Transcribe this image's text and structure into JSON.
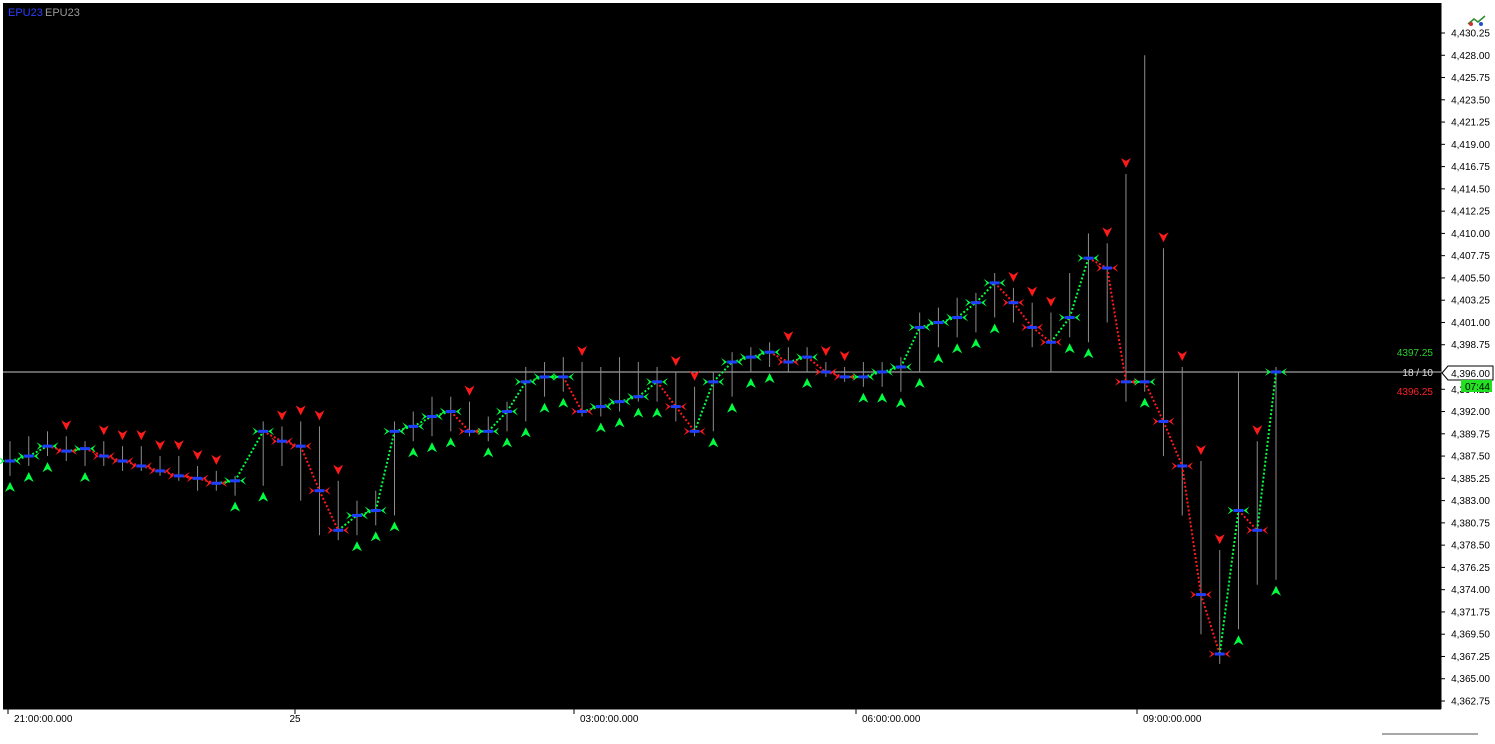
{
  "symbol": {
    "primary": "EPU23",
    "secondary": "EPU23"
  },
  "colors": {
    "background": "#000000",
    "axis_bg": "#ffffff",
    "bar": "#1f3fff",
    "wick": "#8c8c8c",
    "buy_arrow": "#00ff40",
    "sell_arrow": "#ff1a1a",
    "up_trail": "#00ff40",
    "down_trail": "#ff1a1a",
    "crosshair": "#c8c8c8"
  },
  "icons": {
    "top_right": "chart-options-icon"
  },
  "price_axis": {
    "ticks": [
      "4,430.25",
      "4,428.00",
      "4,425.75",
      "4,423.50",
      "4,421.25",
      "4,419.00",
      "4,416.75",
      "4,414.50",
      "4,412.25",
      "4,410.00",
      "4,407.75",
      "4,405.50",
      "4,403.25",
      "4,401.00",
      "4,398.75",
      "4,394.25",
      "4,392.00",
      "4,389.75",
      "4,387.50",
      "4,385.25",
      "4,383.00",
      "4,380.75",
      "4,378.50",
      "4,376.25",
      "4,374.00",
      "4,371.75",
      "4,369.50",
      "4,367.25",
      "4,365.00",
      "4,362.75"
    ],
    "current_price_label": "4,396.00",
    "countdown": "07:44"
  },
  "time_axis": {
    "labels": [
      "21:00:00.000",
      "25",
      "03:00:00.000",
      "06:00:00.000",
      "09:00:00.000"
    ]
  },
  "overlay": {
    "ask_label": "4397.25",
    "counter_label": "18 / 10",
    "bid_label": "4396.25"
  },
  "chart_data": {
    "type": "candlestick",
    "title": "",
    "xlabel": "",
    "ylabel": "",
    "ylim": [
      4361.5,
      4432
    ],
    "grid": false,
    "x_axis_labels": [
      "21:00:00.000",
      "25",
      "03:00:00.000",
      "06:00:00.000",
      "09:00:00.000"
    ],
    "bar_index_range": [
      0,
      135
    ],
    "crosshair_price": 4396.0,
    "bars": [
      {
        "i": 0,
        "high": 4389.0,
        "low": 4385.5,
        "close": 4387.0
      },
      {
        "i": 2,
        "high": 4389.5,
        "low": 4386.5,
        "close": 4387.5
      },
      {
        "i": 4,
        "high": 4390.0,
        "low": 4387.5,
        "close": 4388.5
      },
      {
        "i": 6,
        "high": 4389.5,
        "low": 4387.0,
        "close": 4388.0
      },
      {
        "i": 8,
        "high": 4389.0,
        "low": 4386.5,
        "close": 4388.25
      },
      {
        "i": 10,
        "high": 4389.0,
        "low": 4386.5,
        "close": 4387.5
      },
      {
        "i": 12,
        "high": 4388.5,
        "low": 4386.0,
        "close": 4387.0
      },
      {
        "i": 14,
        "high": 4388.5,
        "low": 4386.0,
        "close": 4386.5
      },
      {
        "i": 16,
        "high": 4387.5,
        "low": 4385.5,
        "close": 4386.0
      },
      {
        "i": 18,
        "high": 4387.5,
        "low": 4385.0,
        "close": 4385.5
      },
      {
        "i": 20,
        "high": 4386.5,
        "low": 4384.0,
        "close": 4385.25
      },
      {
        "i": 22,
        "high": 4386.0,
        "low": 4384.0,
        "close": 4384.75
      },
      {
        "i": 24,
        "high": 4385.5,
        "low": 4383.5,
        "close": 4385.0
      },
      {
        "i": 27,
        "high": 4391.0,
        "low": 4384.5,
        "close": 4390.0
      },
      {
        "i": 29,
        "high": 4390.5,
        "low": 4386.5,
        "close": 4389.0
      },
      {
        "i": 31,
        "high": 4391.0,
        "low": 4383.0,
        "close": 4388.5
      },
      {
        "i": 33,
        "high": 4390.5,
        "low": 4379.5,
        "close": 4384.0
      },
      {
        "i": 35,
        "high": 4385.0,
        "low": 4379.0,
        "close": 4380.0
      },
      {
        "i": 37,
        "high": 4383.0,
        "low": 4379.5,
        "close": 4381.5
      },
      {
        "i": 39,
        "high": 4384.0,
        "low": 4380.5,
        "close": 4382.0
      },
      {
        "i": 41,
        "high": 4391.0,
        "low": 4381.5,
        "close": 4390.0
      },
      {
        "i": 43,
        "high": 4392.0,
        "low": 4389.0,
        "close": 4390.5
      },
      {
        "i": 45,
        "high": 4393.5,
        "low": 4389.5,
        "close": 4391.5
      },
      {
        "i": 47,
        "high": 4393.5,
        "low": 4390.0,
        "close": 4392.0
      },
      {
        "i": 49,
        "high": 4393.0,
        "low": 4389.5,
        "close": 4390.0
      },
      {
        "i": 51,
        "high": 4391.5,
        "low": 4389.0,
        "close": 4390.0
      },
      {
        "i": 53,
        "high": 4393.0,
        "low": 4390.0,
        "close": 4392.0
      },
      {
        "i": 55,
        "high": 4396.5,
        "low": 4391.0,
        "close": 4395.0
      },
      {
        "i": 57,
        "high": 4397.0,
        "low": 4393.5,
        "close": 4395.5
      },
      {
        "i": 59,
        "high": 4397.5,
        "low": 4394.0,
        "close": 4395.5
      },
      {
        "i": 61,
        "high": 4397.0,
        "low": 4391.5,
        "close": 4392.0
      },
      {
        "i": 63,
        "high": 4396.5,
        "low": 4391.5,
        "close": 4392.5
      },
      {
        "i": 65,
        "high": 4397.5,
        "low": 4392.0,
        "close": 4393.0
      },
      {
        "i": 67,
        "high": 4397.0,
        "low": 4393.0,
        "close": 4393.5
      },
      {
        "i": 69,
        "high": 4396.5,
        "low": 4393.0,
        "close": 4395.0
      },
      {
        "i": 71,
        "high": 4396.0,
        "low": 4391.0,
        "close": 4392.5
      },
      {
        "i": 73,
        "high": 4394.5,
        "low": 4389.5,
        "close": 4390.0
      },
      {
        "i": 75,
        "high": 4396.0,
        "low": 4390.0,
        "close": 4395.0
      },
      {
        "i": 77,
        "high": 4398.0,
        "low": 4393.5,
        "close": 4397.0
      },
      {
        "i": 79,
        "high": 4398.5,
        "low": 4396.0,
        "close": 4397.5
      },
      {
        "i": 81,
        "high": 4399.0,
        "low": 4396.5,
        "close": 4398.0
      },
      {
        "i": 83,
        "high": 4398.5,
        "low": 4396.0,
        "close": 4397.0
      },
      {
        "i": 85,
        "high": 4398.5,
        "low": 4396.0,
        "close": 4397.5
      },
      {
        "i": 87,
        "high": 4397.0,
        "low": 4395.5,
        "close": 4396.0
      },
      {
        "i": 89,
        "high": 4396.5,
        "low": 4395.0,
        "close": 4395.5
      },
      {
        "i": 91,
        "high": 4397.0,
        "low": 4394.5,
        "close": 4395.5
      },
      {
        "i": 93,
        "high": 4397.0,
        "low": 4394.5,
        "close": 4396.0
      },
      {
        "i": 95,
        "high": 4397.5,
        "low": 4394.0,
        "close": 4396.5
      },
      {
        "i": 97,
        "high": 4402.0,
        "low": 4396.0,
        "close": 4400.5
      },
      {
        "i": 99,
        "high": 4402.5,
        "low": 4398.5,
        "close": 4401.0
      },
      {
        "i": 101,
        "high": 4403.5,
        "low": 4399.5,
        "close": 4401.5
      },
      {
        "i": 103,
        "high": 4404.0,
        "low": 4400.0,
        "close": 4403.0
      },
      {
        "i": 105,
        "high": 4406.0,
        "low": 4401.5,
        "close": 4405.0
      },
      {
        "i": 107,
        "high": 4404.5,
        "low": 4401.0,
        "close": 4403.0
      },
      {
        "i": 109,
        "high": 4403.0,
        "low": 4398.5,
        "close": 4400.5
      },
      {
        "i": 111,
        "high": 4402.0,
        "low": 4396.0,
        "close": 4399.0
      },
      {
        "i": 113,
        "high": 4406.0,
        "low": 4399.5,
        "close": 4401.5
      },
      {
        "i": 115,
        "high": 4410.0,
        "low": 4399.0,
        "close": 4407.5
      },
      {
        "i": 117,
        "high": 4409.0,
        "low": 4401.0,
        "close": 4406.5
      },
      {
        "i": 119,
        "high": 4416.0,
        "low": 4393.0,
        "close": 4395.0
      },
      {
        "i": 121,
        "high": 4428.0,
        "low": 4394.0,
        "close": 4395.0
      },
      {
        "i": 123,
        "high": 4408.5,
        "low": 4387.5,
        "close": 4391.0
      },
      {
        "i": 125,
        "high": 4396.5,
        "low": 4381.5,
        "close": 4386.5
      },
      {
        "i": 127,
        "high": 4387.0,
        "low": 4369.5,
        "close": 4373.5
      },
      {
        "i": 129,
        "high": 4378.0,
        "low": 4366.5,
        "close": 4367.5
      },
      {
        "i": 131,
        "high": 4396.0,
        "low": 4370.0,
        "close": 4382.0
      },
      {
        "i": 133,
        "high": 4389.0,
        "low": 4374.5,
        "close": 4380.0
      },
      {
        "i": 135,
        "high": 4396.5,
        "low": 4375.0,
        "close": 4396.0
      }
    ]
  }
}
